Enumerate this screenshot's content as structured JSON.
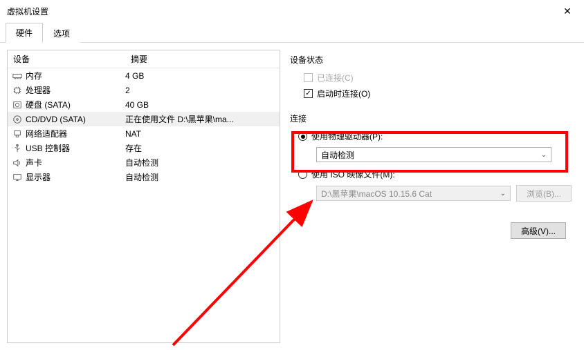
{
  "window": {
    "title": "虚拟机设置"
  },
  "tabs": {
    "active": "硬件",
    "inactive": "选项"
  },
  "table": {
    "col_device": "设备",
    "col_summary": "摘要",
    "rows": [
      {
        "icon": "memory-icon",
        "name": "内存",
        "summary": "4 GB"
      },
      {
        "icon": "cpu-icon",
        "name": "处理器",
        "summary": "2"
      },
      {
        "icon": "disk-icon",
        "name": "硬盘 (SATA)",
        "summary": "40 GB"
      },
      {
        "icon": "cd-icon",
        "name": "CD/DVD (SATA)",
        "summary": "正在使用文件 D:\\黑苹果\\ma..."
      },
      {
        "icon": "network-icon",
        "name": "网络适配器",
        "summary": "NAT"
      },
      {
        "icon": "usb-icon",
        "name": "USB 控制器",
        "summary": "存在"
      },
      {
        "icon": "sound-icon",
        "name": "声卡",
        "summary": "自动检测"
      },
      {
        "icon": "display-icon",
        "name": "显示器",
        "summary": "自动检测"
      }
    ]
  },
  "device_status": {
    "title": "设备状态",
    "connected": "已连接(C)",
    "connect_at_power": "启动时连接(O)"
  },
  "connection": {
    "title": "连接",
    "use_physical": "使用物理驱动器(P):",
    "physical_value": "自动检测",
    "use_iso": "使用 ISO 映像文件(M):",
    "iso_value": "D:\\黑苹果\\macOS 10.15.6 Cat",
    "browse": "浏览(B)..."
  },
  "advanced": "高级(V)..."
}
